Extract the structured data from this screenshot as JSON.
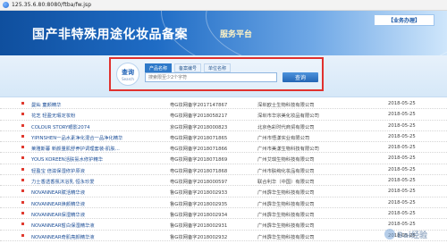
{
  "browser": {
    "url": "125.35.6.80:8080/ftba/fw.jsp"
  },
  "banner": {
    "title": "国产非特殊用途化妆品备案",
    "subtitle": "服务平台",
    "biz_tag": "【业务办理】"
  },
  "search": {
    "badge_main": "查询",
    "badge_en": "Search",
    "tabs": [
      {
        "label": "产品名称",
        "active": true
      },
      {
        "label": "备案编号",
        "active": false
      },
      {
        "label": "单位名称",
        "active": false
      }
    ],
    "placeholder": "搜索限至少2个字符",
    "button_label": "查询"
  },
  "rows": [
    {
      "name": "曼灿 童颜精华",
      "code": "粤G妆网备字2017147867",
      "company": "深圳欧士生物科技有限公司",
      "date": "2018-05-25"
    },
    {
      "name": "花芝 轻盈无瑕定妆粉",
      "code": "粤G妆网备字2018058217",
      "company": "深圳市华宗美化妆品有限公司",
      "date": "2018-05-25"
    },
    {
      "name": "COLOUR STORY眼影2074",
      "code": "京G妆网备字2018000823",
      "company": "北京色彩时代商贸有限公司",
      "date": "2018-05-25"
    },
    {
      "name": "YIPINSHEN一品水素净化混合一品净化精华",
      "code": "粤G妆网备字2018071865",
      "company": "广州市悟漾实业有限公司",
      "date": "2018-05-25"
    },
    {
      "name": "莱雅斯暮 新颜量肌舒养护调理套装-肌肤…",
      "code": "粤G妆网备字2018071866",
      "company": "广州市美漾生物科技有限公司",
      "date": "2018-05-25"
    },
    {
      "name": "YOUS KOREEN活肤氨水修护精华",
      "code": "粤G妆网备字2018071869",
      "company": "广州艾琪生物科技有限公司",
      "date": "2018-05-25"
    },
    {
      "name": "轻盈宝 倍滋保湿修护原液",
      "code": "粤G妆网备字2018071868",
      "company": "广州市肤绚化妆品有限公司",
      "date": "2018-05-25"
    },
    {
      "name": "力士香透香氛沐浴乳 恒永珍爱",
      "code": "粤G妆网备字2018000597",
      "company": "联合利华（中国）有限公司",
      "date": "2018-05-25"
    },
    {
      "name": "NOVANNEAR赋活精华液",
      "code": "鲁G妆网备字2018002933",
      "company": "广州霹华生物科技有限公司",
      "date": "2018-05-25"
    },
    {
      "name": "NOVANNEAR焕颜精华液",
      "code": "鲁G妆网备字2018002935",
      "company": "广州霹华生物科技有限公司",
      "date": "2018-05-25"
    },
    {
      "name": "NOVANNEAR保湿精华液",
      "code": "鲁G妆网备字2018002934",
      "company": "广州霹华生物科技有限公司",
      "date": "2018-05-25"
    },
    {
      "name": "NOVANNEAR皙白保湿精华液",
      "code": "鲁G妆网备字2018002931",
      "company": "广州霹华生物科技有限公司",
      "date": "2018-05-25"
    },
    {
      "name": "NOVANNEAR奇肌亮颜精华液",
      "code": "鲁G妆网备字2018002932",
      "company": "广州霹华生物科技有限公司",
      "date": "2018-05-25"
    }
  ],
  "watermark": "Bai经验",
  "colors": {
    "banner_dark": "#0f4f9e",
    "link": "#1c4e97",
    "highlight_box": "#e0312e"
  }
}
